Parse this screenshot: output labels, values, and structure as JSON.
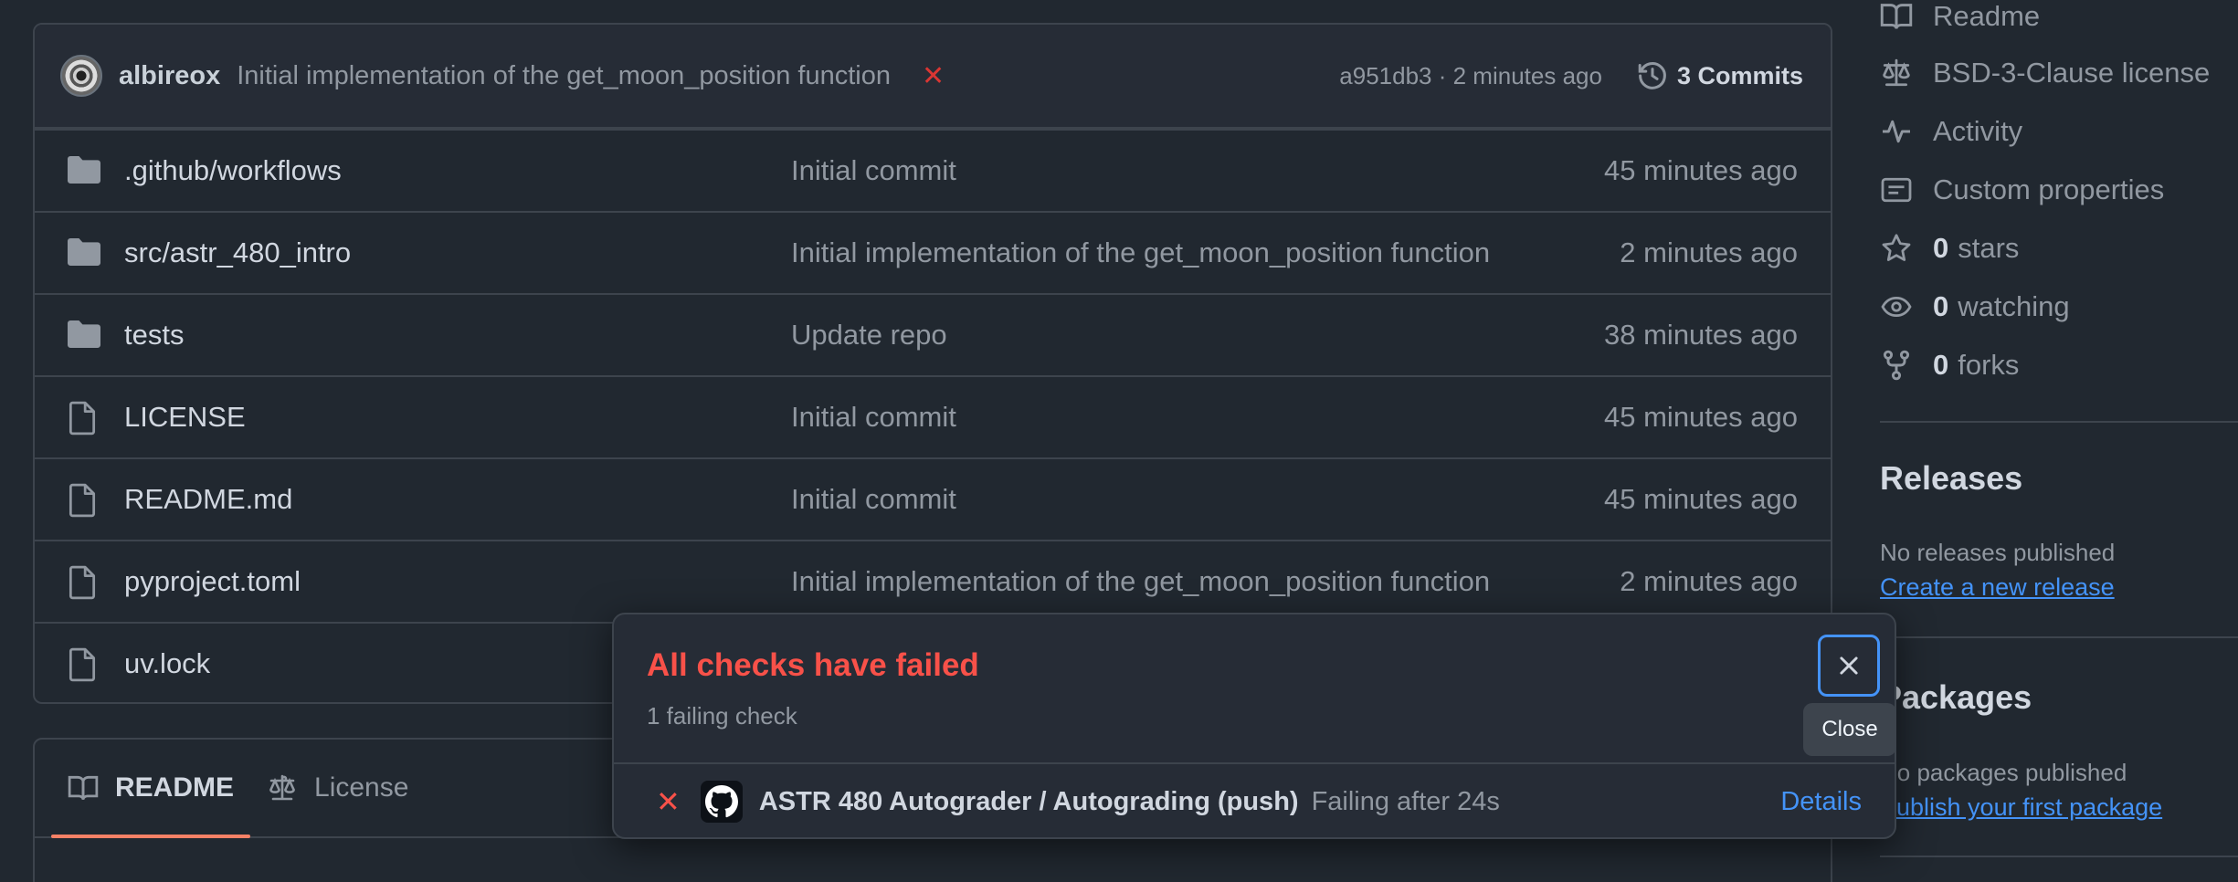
{
  "latest_commit": {
    "author": "albireox",
    "message": "Initial implementation of the get_moon_position function",
    "status_icon": "x-icon",
    "hash_time": "a951db3 · 2 minutes ago",
    "commits_label": "3 Commits"
  },
  "files": [
    {
      "type": "folder",
      "name": ".github/workflows",
      "commit": "Initial commit",
      "time": "45 minutes ago"
    },
    {
      "type": "folder",
      "name": "src/astr_480_intro",
      "commit": "Initial implementation of the get_moon_position function",
      "time": "2 minutes ago"
    },
    {
      "type": "folder",
      "name": "tests",
      "commit": "Update repo",
      "time": "38 minutes ago"
    },
    {
      "type": "file",
      "name": "LICENSE",
      "commit": "Initial commit",
      "time": "45 minutes ago"
    },
    {
      "type": "file",
      "name": "README.md",
      "commit": "Initial commit",
      "time": "45 minutes ago"
    },
    {
      "type": "file",
      "name": "pyproject.toml",
      "commit": "Initial implementation of the get_moon_position function",
      "time": "2 minutes ago"
    },
    {
      "type": "file",
      "name": "uv.lock",
      "commit": "",
      "time": ""
    }
  ],
  "readme_tabs": [
    {
      "label": "README",
      "icon": "book-icon",
      "active": true
    },
    {
      "label": "License",
      "icon": "scale-icon",
      "active": false
    }
  ],
  "sidebar": {
    "links": [
      {
        "icon": "book-icon",
        "label": "Readme"
      },
      {
        "icon": "scale-icon",
        "label": "BSD-3-Clause license"
      },
      {
        "icon": "pulse-icon",
        "label": "Activity"
      },
      {
        "icon": "note-icon",
        "label": "Custom properties"
      }
    ],
    "stats": [
      {
        "icon": "star-icon",
        "count": "0",
        "label": "stars"
      },
      {
        "icon": "eye-icon",
        "count": "0",
        "label": "watching"
      },
      {
        "icon": "fork-icon",
        "count": "0",
        "label": "forks"
      }
    ],
    "releases": {
      "heading": "Releases",
      "text": "No releases published",
      "link": "Create a new release"
    },
    "packages": {
      "heading": "Packages",
      "text": "No packages published",
      "link": "Publish your first package"
    }
  },
  "checks_popover": {
    "title": "All checks have failed",
    "subtitle": "1 failing check",
    "close_tooltip": "Close",
    "check": {
      "name": "ASTR 480 Autograder / Autograding (push)",
      "status": "Failing after 24s",
      "details_label": "Details"
    }
  },
  "colors": {
    "background": "#212830",
    "border": "#3d444d",
    "error": "#f85149",
    "link": "#4493f8",
    "tab_underline": "#f78166"
  }
}
